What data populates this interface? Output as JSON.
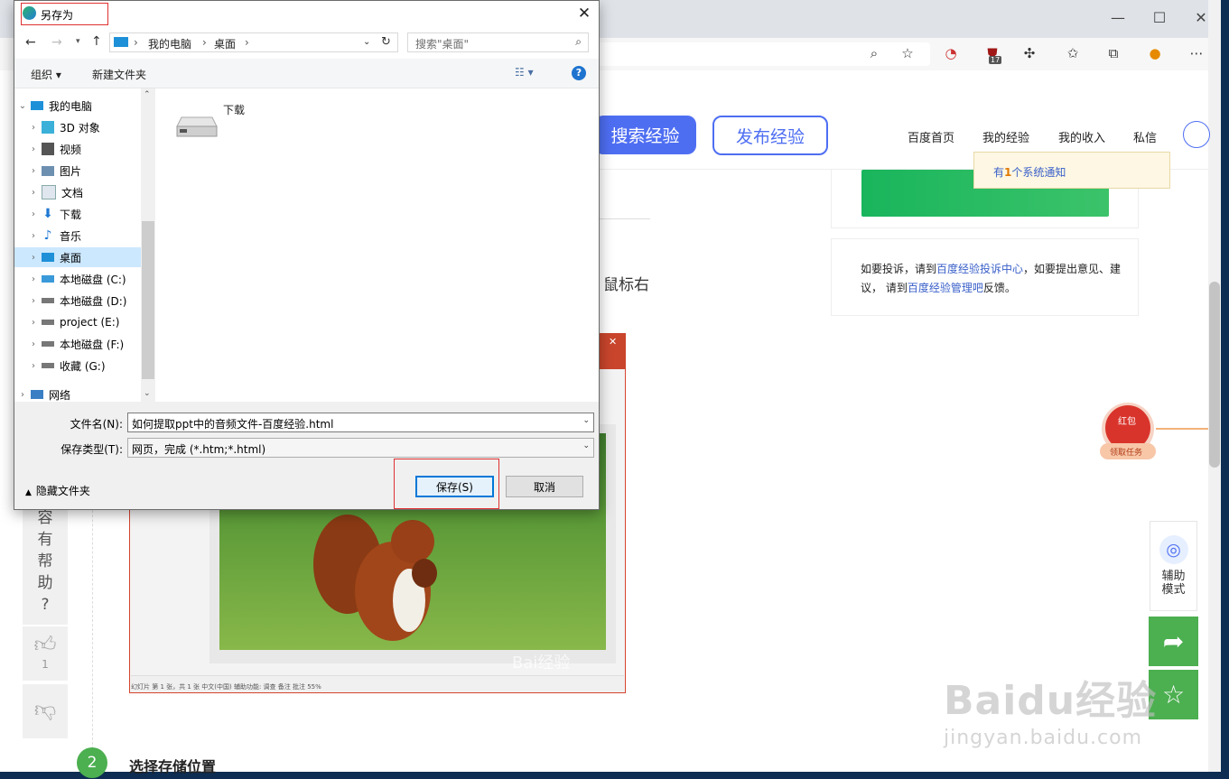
{
  "dialog": {
    "title": "另存为",
    "close": "✕",
    "path": {
      "root": "我的电脑",
      "current": "桌面"
    },
    "search_placeholder": "搜索\"桌面\"",
    "toolbar": {
      "organize": "组织 ▾",
      "new_folder": "新建文件夹",
      "help": "?"
    },
    "tree": [
      {
        "label": "我的电脑",
        "icon": "computer-icon",
        "level": 0,
        "expanded": true
      },
      {
        "label": "3D 对象",
        "icon": "cube-icon",
        "level": 1
      },
      {
        "label": "视频",
        "icon": "video-icon",
        "level": 1
      },
      {
        "label": "图片",
        "icon": "picture-icon",
        "level": 1
      },
      {
        "label": "文档",
        "icon": "document-icon",
        "level": 1
      },
      {
        "label": "下载",
        "icon": "download-icon",
        "level": 1
      },
      {
        "label": "音乐",
        "icon": "music-icon",
        "level": 1
      },
      {
        "label": "桌面",
        "icon": "desktop-icon",
        "level": 1,
        "selected": true
      },
      {
        "label": "本地磁盘 (C:)",
        "icon": "system-drive-icon",
        "level": 1
      },
      {
        "label": "本地磁盘 (D:)",
        "icon": "drive-icon",
        "level": 1
      },
      {
        "label": "project (E:)",
        "icon": "drive-icon",
        "level": 1
      },
      {
        "label": "本地磁盘 (F:)",
        "icon": "drive-icon",
        "level": 1
      },
      {
        "label": "收藏 (G:)",
        "icon": "drive-icon",
        "level": 1
      },
      {
        "label": "网络",
        "icon": "network-icon",
        "level": 0
      }
    ],
    "files": [
      {
        "name": "下载",
        "icon": "drive-icon"
      }
    ],
    "filename_label": "文件名(N):",
    "filename_value": "如何提取ppt中的音频文件-百度经验.html",
    "filetype_label": "保存类型(T):",
    "filetype_value": "网页，完成 (*.htm;*.html)",
    "hide_folders": "隐藏文件夹",
    "save": "保存(S)",
    "cancel": "取消"
  },
  "page": {
    "search_button": "搜索经验",
    "publish_button": "发布经验",
    "nav": [
      "百度首页",
      "我的经验",
      "我的收入",
      "私信"
    ],
    "notice_prefix": "有",
    "notice_count": "1",
    "notice_suffix": "个系统通知",
    "complaint": {
      "t1": "如要投诉，请到",
      "link1": "百度经验投诉中心",
      "t2": "，如要提出意见、建议， 请到",
      "link2": "百度经验管理吧",
      "t3": "反馈。"
    },
    "side_hint": "鼠标右",
    "vertical_text": [
      "容",
      "有",
      "帮",
      "助",
      "?"
    ],
    "like_count": "1",
    "step_number": "2",
    "step_title": "选择存储位置",
    "redpack_top": "红包",
    "redpack_bottom": "领取任务",
    "assist_label": "辅助模式",
    "watermark_logo": "Baidu经验",
    "watermark_url": "jingyan.baidu.com",
    "ppt_watermark": "Bai经验",
    "ppt_status": "幻灯片 第 1 张，共 1 张   中文(中国)   辅助功能: 调查          备注   批注                         55%",
    "browser_badge": "17"
  },
  "colors": {
    "accent": "#4e6ef2",
    "green": "#4caf50",
    "red_highlight": "#e03030"
  }
}
